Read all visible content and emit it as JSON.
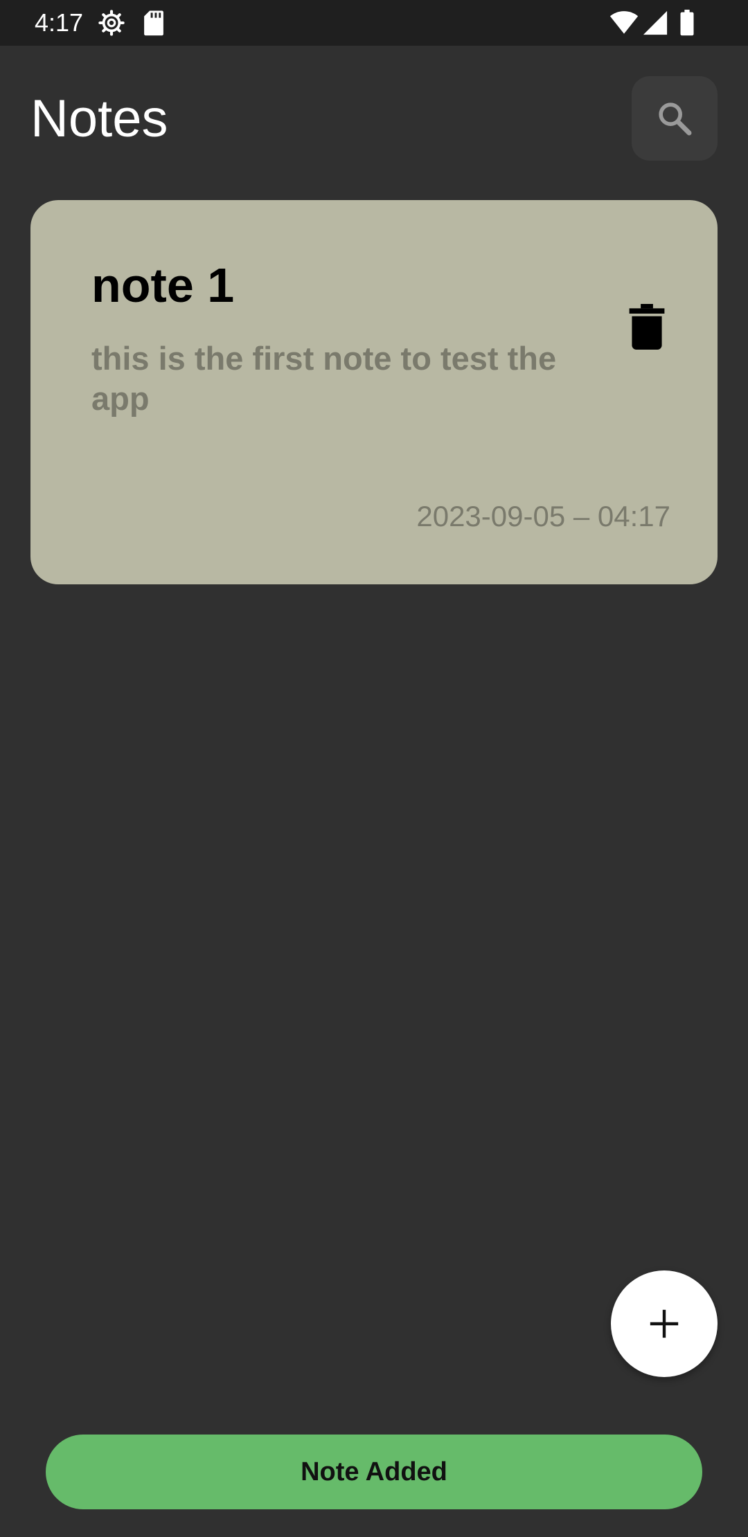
{
  "status_bar": {
    "time": "4:17",
    "icons": [
      "settings-gear-icon",
      "sd-card-icon",
      "wifi-icon",
      "cell-signal-icon",
      "battery-icon"
    ]
  },
  "header": {
    "title": "Notes",
    "search_icon": "search-icon"
  },
  "notes": [
    {
      "title": "note 1",
      "body": "this is the first note to test the app",
      "timestamp": "2023-09-05 – 04:17",
      "delete_icon": "trash-icon"
    }
  ],
  "fab": {
    "icon": "plus-icon"
  },
  "snackbar": {
    "message": "Note Added"
  },
  "colors": {
    "background": "#303030",
    "status_bar": "#1f1f1f",
    "card": "#b8b8a3",
    "card_secondary_text": "#7a7a6c",
    "search_button_bg": "#3b3b3b",
    "fab_bg": "#ffffff",
    "snackbar_bg": "#66bb6a"
  }
}
